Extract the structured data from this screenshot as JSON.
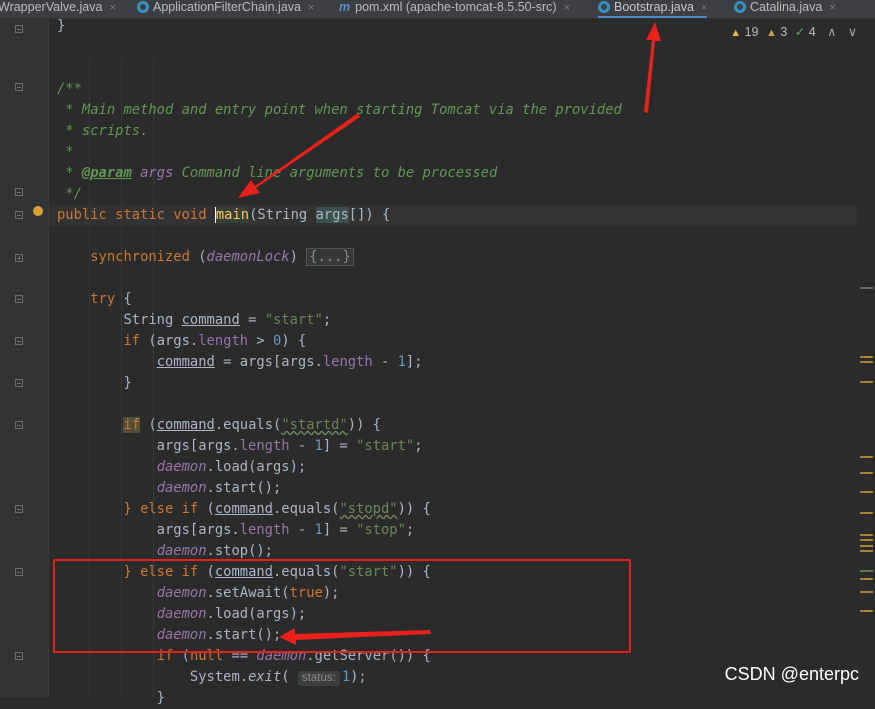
{
  "tabs": [
    {
      "label": "WrapperValve.java",
      "icon": "java-class-icon",
      "active": false
    },
    {
      "label": "ApplicationFilterChain.java",
      "icon": "java-class-icon",
      "active": false
    },
    {
      "label": "pom.xml (apache-tomcat-8.5.50-src)",
      "icon": "maven-icon",
      "icon_glyph": "m",
      "active": false
    },
    {
      "label": "Bootstrap.java",
      "icon": "java-class-icon",
      "active": true
    },
    {
      "label": "Catalina.java",
      "icon": "java-class-icon",
      "active": false
    }
  ],
  "tab_close_glyph": "×",
  "inspections": {
    "warnings": "19",
    "weak_warnings": "3",
    "ok": "4"
  },
  "code": {
    "l0": "}",
    "l3": "/**",
    "l4": " * Main method and entry point when starting Tomcat via the provided",
    "l5": " * scripts.",
    "l6": " *",
    "l7_tag": "@param",
    "l7_arg": "args",
    "l7_rest": " Command line arguments to be processed",
    "l8": " */",
    "l9_kw": "public static void",
    "l9_fn": "main",
    "l9_p1": "(String ",
    "l9_args": "args",
    "l9_p2": "[]) {",
    "l11_kw": "synchronized",
    "l11_lock": "daemonLock",
    "l11_fold": "{...}",
    "l13_kw": "try",
    "l13_brace": " {",
    "l14_type": "String ",
    "l14_var": "command",
    "l14_eq": " = ",
    "l14_str": "\"start\"",
    "l15_length": "length",
    "l15_zero": "0",
    "l16_rhs": " = args[args.",
    "l16_length": "length",
    "l16_one": "1",
    "l17": "}",
    "l19_startd": "\"startd\"",
    "l20_length": "length",
    "l20_one": "1",
    "l20_start": "\"start\"",
    "daemon": "daemon",
    "load_args": ".load(args);",
    "start_call": ".start();",
    "stop_call": ".stop();",
    "l22_else": "} else if",
    "l22_stopd": "\"stopd\"",
    "l23_stop": "\"stop\"",
    "l25_start": "\"start\"",
    "l26_await": ".setAwait(",
    "l26_true": "true",
    "l29_kw": "if",
    "l29_null": "null",
    "l29_rest": ".getServer()) {",
    "l30_sys": "System.",
    "l30_exit": "exit",
    "l30_hint": "status:",
    "l30_one": "1"
  },
  "watermark": "CSDN @enterpc"
}
